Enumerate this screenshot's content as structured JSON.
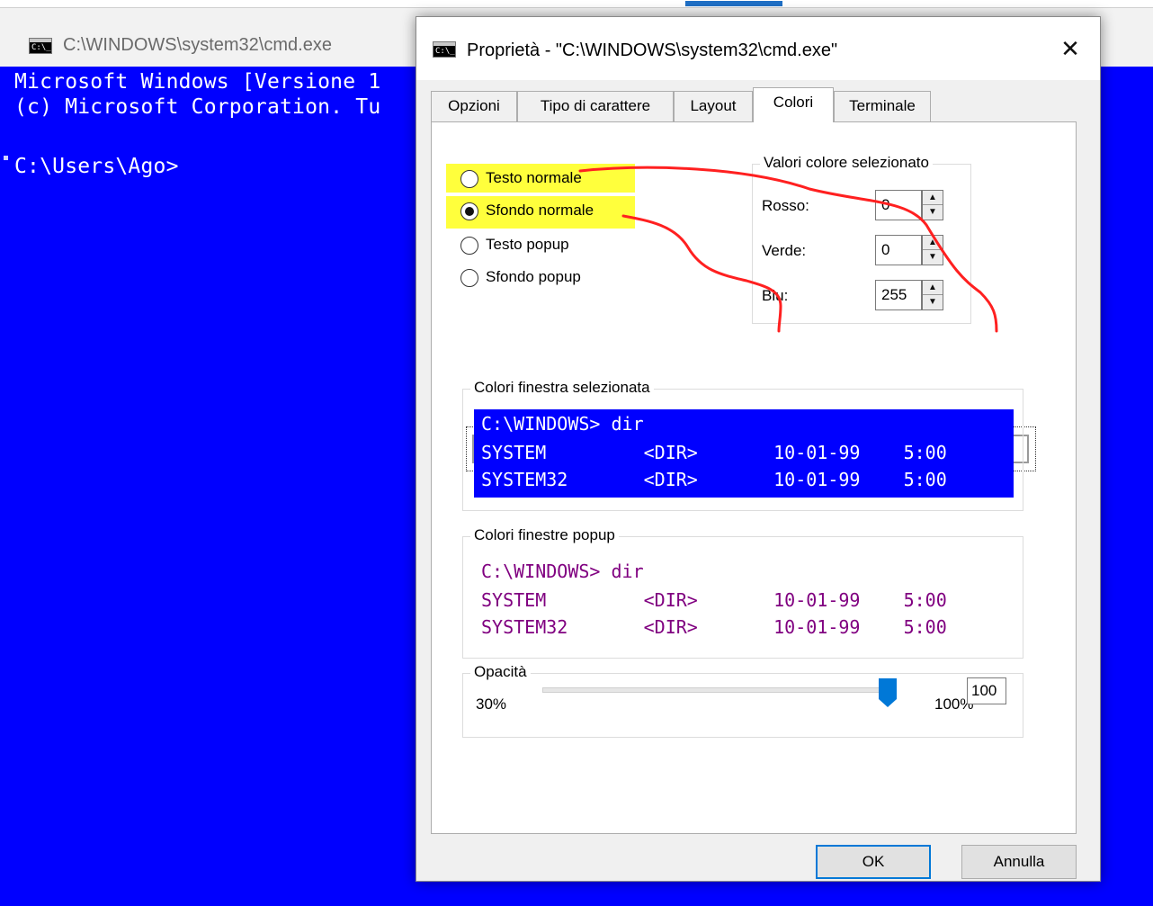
{
  "console": {
    "title": "C:\\WINDOWS\\system32\\cmd.exe",
    "lines": [
      "Microsoft Windows [Versione 1",
      "(c) Microsoft Corporation. Tu",
      "",
      "C:\\Users\\Ago>"
    ],
    "background_color": "#0000ff",
    "text_color": "#ffffff"
  },
  "dialog": {
    "title": "Proprietà - \"C:\\WINDOWS\\system32\\cmd.exe\"",
    "tabs": [
      {
        "label": "Opzioni",
        "active": false
      },
      {
        "label": "Tipo di carattere",
        "active": false
      },
      {
        "label": "Layout",
        "active": false
      },
      {
        "label": "Colori",
        "active": true
      },
      {
        "label": "Terminale",
        "active": false
      }
    ],
    "radios": [
      {
        "label": "Testo normale",
        "selected": false,
        "highlighted": true
      },
      {
        "label": "Sfondo normale",
        "selected": true,
        "highlighted": true
      },
      {
        "label": "Testo popup",
        "selected": false,
        "highlighted": false
      },
      {
        "label": "Sfondo popup",
        "selected": false,
        "highlighted": false
      }
    ],
    "selected_values": {
      "group_label": "Valori colore selezionato",
      "red_label": "Rosso:",
      "red": "0",
      "green_label": "Verde:",
      "green": "0",
      "blue_label": "Blu:",
      "blue": "255"
    },
    "palette": [
      "#000000",
      "#000080",
      "#008000",
      "#008080",
      "#800000",
      "#800080",
      "#808000",
      "#c0c0c0",
      "#808080",
      "#0000ff",
      "#00ff00",
      "#00ffff",
      "#ff0000",
      "#ff00ff",
      "#ffff00",
      "#ffffff"
    ],
    "palette_selected_index": 9,
    "window_preview": {
      "group_label": "Colori finestra selezionata",
      "lines": [
        "C:\\WINDOWS> dir",
        "SYSTEM         <DIR>       10-01-99    5:00",
        "SYSTEM32       <DIR>       10-01-99    5:00"
      ],
      "background_color": "#0000ff",
      "text_color": "#ffffff"
    },
    "popup_preview": {
      "group_label": "Colori finestre popup",
      "lines": [
        "C:\\WINDOWS> dir",
        "SYSTEM         <DIR>       10-01-99    5:00",
        "SYSTEM32       <DIR>       10-01-99    5:00"
      ],
      "background_color": "#ffffff",
      "text_color": "#800080"
    },
    "opacity": {
      "group_label": "Opacità",
      "min_label": "30%",
      "max_label": "100%",
      "value": "100"
    },
    "ok_label": "OK",
    "cancel_label": "Annulla"
  },
  "colors": {
    "highlight": "#ffff3c",
    "annotation": "#ff0000",
    "focus_accent": "#0078d7"
  }
}
